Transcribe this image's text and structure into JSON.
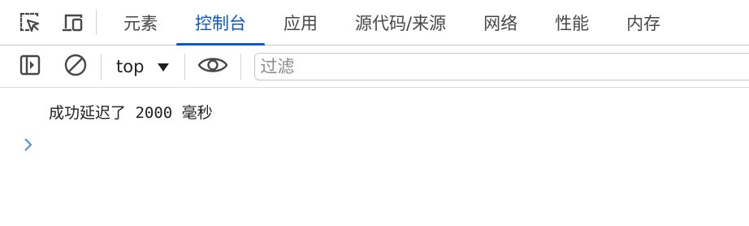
{
  "tabs": [
    {
      "label": "元素",
      "active": false
    },
    {
      "label": "控制台",
      "active": true
    },
    {
      "label": "应用",
      "active": false
    },
    {
      "label": "源代码/来源",
      "active": false
    },
    {
      "label": "网络",
      "active": false
    },
    {
      "label": "性能",
      "active": false
    },
    {
      "label": "内存",
      "active": false
    }
  ],
  "icons": {
    "inspect": "inspect-element-icon",
    "device": "device-toolbar-icon",
    "sidebar": "show-sidebar-icon",
    "clear": "clear-console-icon",
    "dropdown": "dropdown-arrow-icon",
    "eye": "live-expression-icon",
    "prompt": "console-prompt-chevron-icon"
  },
  "toolbar": {
    "context": "top",
    "filter_placeholder": "过滤"
  },
  "console": {
    "messages": [
      "成功延迟了 2000 毫秒"
    ]
  },
  "colors": {
    "accent": "#0b57d0",
    "prompt": "#5b8fd8"
  }
}
